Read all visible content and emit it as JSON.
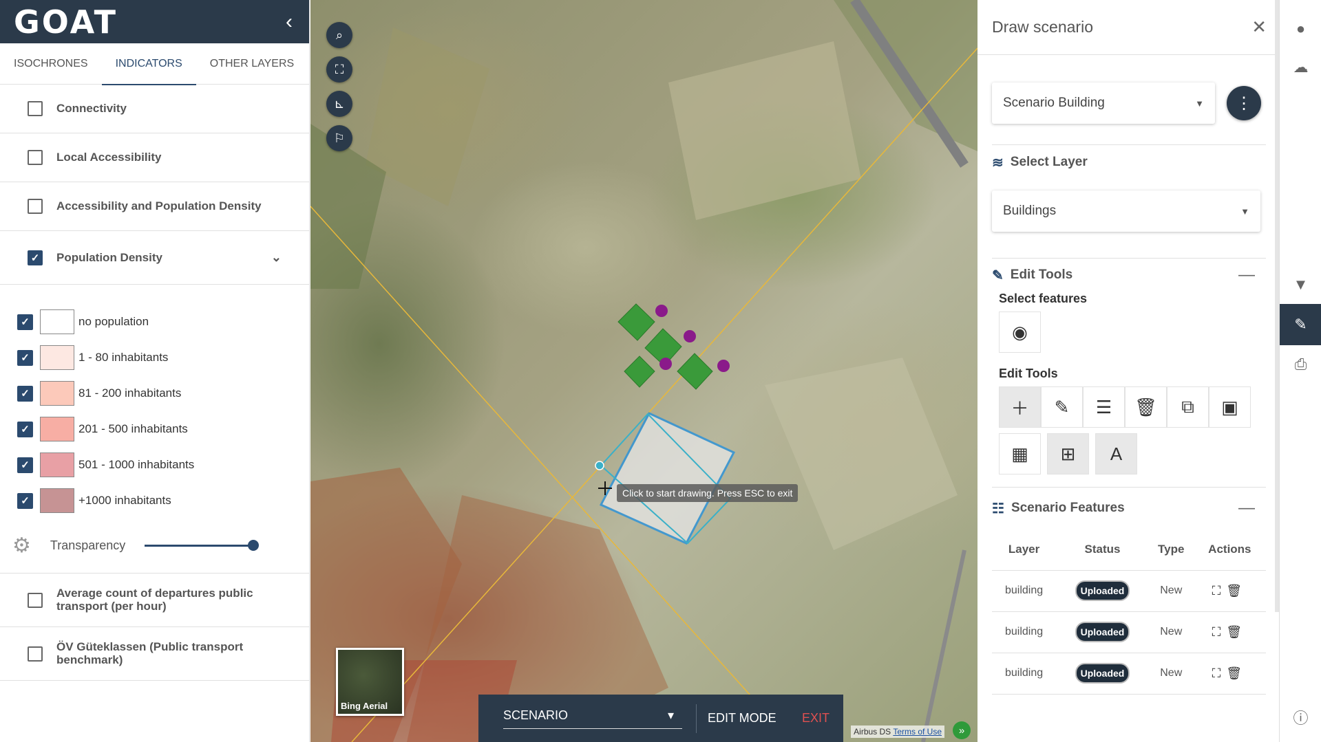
{
  "app": {
    "logo": "GOAT",
    "collapse_icon": "‹"
  },
  "tabs": [
    {
      "label": "ISOCHRONES"
    },
    {
      "label": "INDICATORS",
      "active": true
    },
    {
      "label": "OTHER LAYERS"
    }
  ],
  "indicators": {
    "connectivity": "Connectivity",
    "local_accessibility": "Local Accessibility",
    "accessibility_pop_density": "Accessibility and Population Density",
    "population_density": "Population Density",
    "avg_departures": "Average count of departures public transport (per hour)",
    "oev": "ÖV Güteklassen (Public transport benchmark)"
  },
  "legend": [
    {
      "label": "no population",
      "color": "#ffffff"
    },
    {
      "label": "1 - 80 inhabitants",
      "color": "#fde8e2"
    },
    {
      "label": "81 - 200 inhabitants",
      "color": "#fcc9ba"
    },
    {
      "label": "201 - 500 inhabitants",
      "color": "#f7aea4"
    },
    {
      "label": "501 - 1000 inhabitants",
      "color": "#e8a0a5"
    },
    {
      "label": "+1000 inhabitants",
      "color": "#c69394"
    }
  ],
  "transparency": {
    "label": "Transparency",
    "value": 1.0
  },
  "map": {
    "tooltip": "Click to start drawing. Press ESC to exit",
    "basemap_label": "Bing Aerial",
    "scenario_label": "SCENARIO",
    "edit_mode_label": "EDIT MODE",
    "exit_label": "EXIT",
    "attribution_text": "Airbus DS",
    "terms_link": "Terms of Use"
  },
  "panel": {
    "title": "Draw scenario",
    "scenario_value": "Scenario Building",
    "select_layer_title": "Select Layer",
    "layer_value": "Buildings",
    "edit_tools_title": "Edit Tools",
    "select_features_label": "Select features",
    "edit_tools_sub": "Edit Tools",
    "scenario_features_title": "Scenario Features",
    "table": {
      "headers": [
        "Layer",
        "Status",
        "Type",
        "Actions"
      ],
      "rows": [
        {
          "layer": "building",
          "status": "Uploaded",
          "type": "New"
        },
        {
          "layer": "building",
          "status": "Uploaded",
          "type": "New"
        },
        {
          "layer": "building",
          "status": "Uploaded",
          "type": "New"
        }
      ]
    }
  },
  "colors": {
    "primary": "#2b3a4a",
    "accent": "#2b4a6e",
    "exit": "#e05050"
  }
}
